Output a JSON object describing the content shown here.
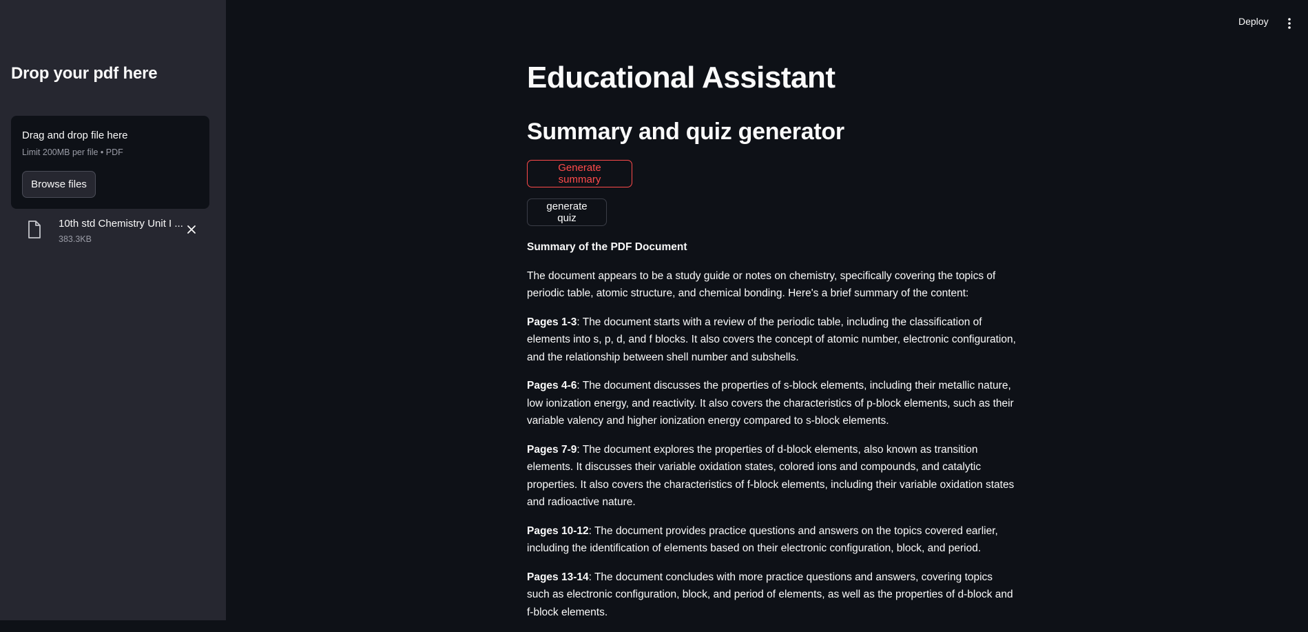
{
  "sidebar": {
    "title": "Drop your pdf here",
    "uploader": {
      "title": "Drag and drop file here",
      "limit": "Limit 200MB per file • PDF",
      "browse_label": "Browse files"
    },
    "file": {
      "name": "10th std Chemistry Unit I ...",
      "size": "383.3KB",
      "icon": "file-icon"
    }
  },
  "header": {
    "deploy_label": "Deploy",
    "menu_icon": "kebab-menu-icon"
  },
  "main": {
    "title": "Educational Assistant",
    "subtitle": "Summary and quiz generator",
    "generate_summary_label": "Generate summary",
    "generate_quiz_label": "generate quiz",
    "summary": {
      "heading": "Summary of the PDF Document",
      "intro": "The document appears to be a study guide or notes on chemistry, specifically covering the topics of periodic table, atomic structure, and chemical bonding. Here's a brief summary of the content:",
      "sections": [
        {
          "label": "Pages 1-3",
          "text": ": The document starts with a review of the periodic table, including the classification of elements into s, p, d, and f blocks. It also covers the concept of atomic number, electronic configuration, and the relationship between shell number and subshells."
        },
        {
          "label": "Pages 4-6",
          "text": ": The document discusses the properties of s-block elements, including their metallic nature, low ionization energy, and reactivity. It also covers the characteristics of p-block elements, such as their variable valency and higher ionization energy compared to s-block elements."
        },
        {
          "label": "Pages 7-9",
          "text": ": The document explores the properties of d-block elements, also known as transition elements. It discusses their variable oxidation states, colored ions and compounds, and catalytic properties. It also covers the characteristics of f-block elements, including their variable oxidation states and radioactive nature."
        },
        {
          "label": "Pages 10-12",
          "text": ": The document provides practice questions and answers on the topics covered earlier, including the identification of elements based on their electronic configuration, block, and period."
        },
        {
          "label": "Pages 13-14",
          "text": ": The document concludes with more practice questions and answers, covering topics such as electronic configuration, block, and period of elements, as well as the properties of d-block and f-block elements."
        }
      ]
    }
  },
  "colors": {
    "background": "#0e1117",
    "sidebar": "#262730",
    "accent": "#ff4b4b",
    "text": "#fafafa",
    "muted": "#9a9ca6"
  }
}
